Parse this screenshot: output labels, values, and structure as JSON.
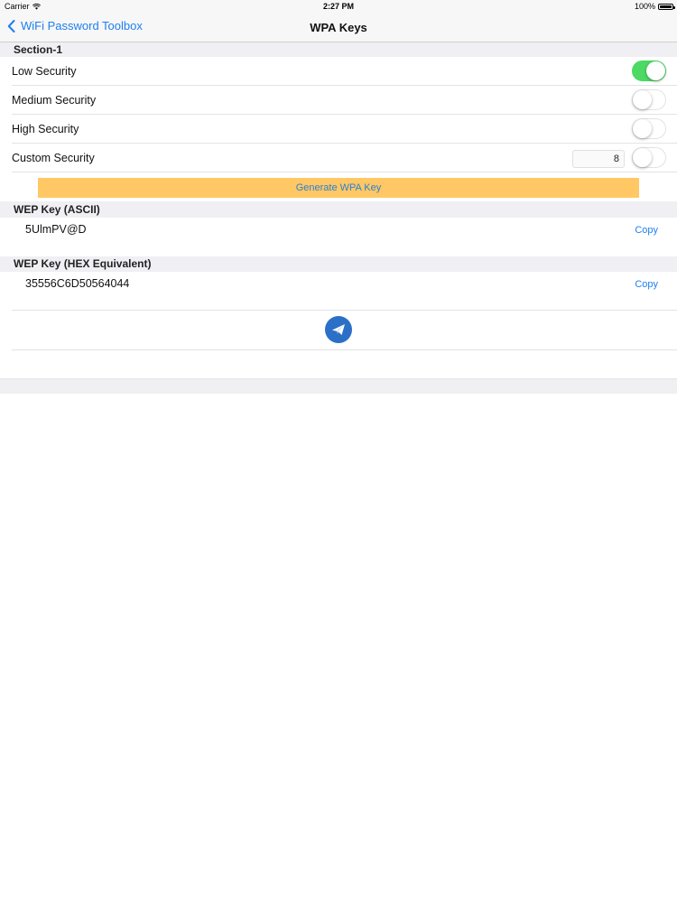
{
  "status_bar": {
    "carrier": "Carrier",
    "time": "2:27 PM",
    "battery": "100%"
  },
  "nav": {
    "back_label": "WiFi Password Toolbox",
    "title": "WPA Keys"
  },
  "section1": {
    "header": "Section-1",
    "rows": [
      {
        "label": "Low Security",
        "toggle_on": true
      },
      {
        "label": "Medium Security",
        "toggle_on": false
      },
      {
        "label": "High Security",
        "toggle_on": false
      },
      {
        "label": "Custom Security",
        "toggle_on": false,
        "length_value": "8"
      }
    ]
  },
  "generate_label": "Generate WPA Key",
  "ascii": {
    "header": "WEP Key (ASCII)",
    "value": "5UlmPV@D",
    "copy_label": "Copy"
  },
  "hex": {
    "header": "WEP Key (HEX Equivalent)",
    "value": "35556C6D50564044",
    "copy_label": "Copy"
  },
  "colors": {
    "accent": "#1e7ff0",
    "toggle_on": "#4cd964",
    "generate_bg": "#ffc864",
    "mail_button": "#2c6fc7"
  },
  "icons": {
    "back": "chevron-left-icon",
    "wifi": "wifi-icon",
    "battery": "battery-icon",
    "mail": "mail-send-icon"
  }
}
